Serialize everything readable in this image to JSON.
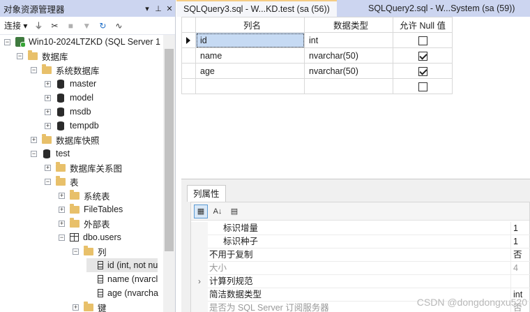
{
  "object_explorer": {
    "title": "对象资源管理器",
    "title_buttons": [
      "▾",
      "⊥",
      "✕"
    ],
    "toolbar": {
      "connect_label": "连接 ▾"
    },
    "tree": [
      {
        "label": "Win10-2024LTZKD (SQL Server 1",
        "icon": "server-icon",
        "expander": "−"
      },
      {
        "label": "数据库",
        "icon": "folder-icon",
        "expander": "−"
      },
      {
        "label": "系统数据库",
        "icon": "folder-icon",
        "expander": "−"
      },
      {
        "label": "master",
        "icon": "database-icon",
        "expander": "+"
      },
      {
        "label": "model",
        "icon": "database-icon",
        "expander": "+"
      },
      {
        "label": "msdb",
        "icon": "database-icon",
        "expander": "+"
      },
      {
        "label": "tempdb",
        "icon": "database-icon",
        "expander": "+"
      },
      {
        "label": "数据库快照",
        "icon": "folder-icon",
        "expander": "+"
      },
      {
        "label": "test",
        "icon": "database-icon",
        "expander": "−"
      },
      {
        "label": "数据库关系图",
        "icon": "folder-icon",
        "expander": "+"
      },
      {
        "label": "表",
        "icon": "folder-icon",
        "expander": "−"
      },
      {
        "label": "系统表",
        "icon": "folder-icon",
        "expander": "+"
      },
      {
        "label": "FileTables",
        "icon": "folder-icon",
        "expander": "+"
      },
      {
        "label": "外部表",
        "icon": "folder-icon",
        "expander": "+"
      },
      {
        "label": "dbo.users",
        "icon": "table-icon",
        "expander": "−"
      },
      {
        "label": "列",
        "icon": "folder-icon",
        "expander": "−"
      },
      {
        "label": "id (int, not nu",
        "icon": "column-icon",
        "expander": ""
      },
      {
        "label": "name (nvarcl",
        "icon": "column-icon",
        "expander": ""
      },
      {
        "label": "age (nvarcha",
        "icon": "column-icon",
        "expander": ""
      },
      {
        "label": "键",
        "icon": "folder-icon",
        "expander": "+"
      }
    ]
  },
  "tabs": {
    "active": "SQLQuery3.sql - W...KD.test (sa (56))",
    "other": "SQLQuery2.sql - W...System (sa (59))"
  },
  "grid": {
    "headers": [
      "列名",
      "数据类型",
      "允许 Null 值"
    ],
    "rows": [
      {
        "name": "id",
        "type": "int",
        "allow_null": false,
        "current": true
      },
      {
        "name": "name",
        "type": "nvarchar(50)",
        "allow_null": true,
        "current": false
      },
      {
        "name": "age",
        "type": "nvarchar(50)",
        "allow_null": true,
        "current": false
      },
      {
        "name": "",
        "type": "",
        "allow_null": false,
        "current": false
      }
    ]
  },
  "properties": {
    "tab_label": "列属性",
    "rows": [
      {
        "name": "标识增量",
        "value": "1",
        "sub": true,
        "gray": false,
        "gutter": ""
      },
      {
        "name": "标识种子",
        "value": "1",
        "sub": true,
        "gray": false,
        "gutter": ""
      },
      {
        "name": "不用于复制",
        "value": "否",
        "sub": false,
        "gray": false,
        "gutter": ""
      },
      {
        "name": "大小",
        "value": "4",
        "sub": false,
        "gray": true,
        "gutter": ""
      },
      {
        "name": "计算列规范",
        "value": "",
        "sub": false,
        "gray": false,
        "gutter": "›"
      },
      {
        "name": "简洁数据类型",
        "value": "int",
        "sub": false,
        "gray": false,
        "gutter": ""
      },
      {
        "name": "是否为 SQL Server 订阅服务器",
        "value": "否",
        "sub": false,
        "gray": true,
        "gutter": ""
      }
    ]
  },
  "watermark": "CSDN @dongdongxu520"
}
